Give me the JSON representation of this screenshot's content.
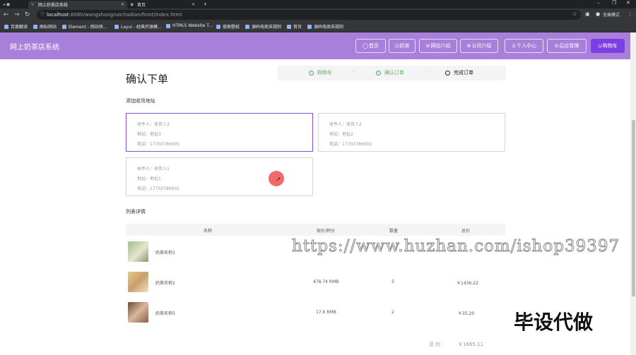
{
  "browser": {
    "tabs": [
      {
        "title": "网上奶茶店系统",
        "active": true
      },
      {
        "title": "首页",
        "active": false
      }
    ],
    "url_host": "localhost",
    "url_path": ":8080/wangshangnaichadian/front/index.html",
    "profile_label": "无痕模式",
    "bookmarks": [
      "百度翻译",
      "图标网站",
      "Element - 网站快...",
      "Layui - 经典开源模...",
      "HTML5 Website T...",
      "搜索壁纸",
      "源码电商采规则",
      "首页",
      "源码电商采规则"
    ]
  },
  "site": {
    "title": "网上奶茶店系统",
    "nav": [
      {
        "label": "首页",
        "icon": "home-icon",
        "glyph": "◯"
      },
      {
        "label": "奶茶",
        "icon": "cup-icon",
        "glyph": "◷"
      },
      {
        "label": "网站介绍",
        "icon": "list-icon",
        "glyph": "≡"
      },
      {
        "label": "公司介绍",
        "icon": "building-icon",
        "glyph": "⊕"
      },
      {
        "label": "个人中心",
        "icon": "user-icon",
        "glyph": "♙"
      },
      {
        "label": "后台管理",
        "icon": "link-icon",
        "glyph": "⊘"
      },
      {
        "label": "购物车",
        "icon": "cart-icon",
        "glyph": "⊔"
      }
    ]
  },
  "page": {
    "title": "确认下单",
    "steps": [
      {
        "label": "购物车",
        "done": true
      },
      {
        "label": "确认订单",
        "done": true
      },
      {
        "label": "完成订单",
        "done": false
      }
    ],
    "address_section_label": "添加收货地址",
    "addresses": [
      {
        "name": "收件人：收货人3",
        "address": "地址：地址3",
        "phone": "电话：17703786905"
      },
      {
        "name": "收件人：收货人2",
        "address": "地址：地址2",
        "phone": "电话：17703786902"
      },
      {
        "name": "收件人：收货人1",
        "address": "地址：地址1",
        "phone": "电话：17703786901"
      }
    ],
    "list_section_label": "列表详情",
    "table_headers": [
      "名称",
      "现价/积分",
      "数量",
      "总价"
    ],
    "rows": [
      {
        "name": "奶茶名称3",
        "price": "",
        "qty": "",
        "total": ""
      },
      {
        "name": "奶茶名称2",
        "price": "478.74 RMB",
        "qty": "3",
        "total": "￥1436.22"
      },
      {
        "name": "奶茶名称5",
        "price": "17.6 RMB",
        "qty": "2",
        "total": "￥35.20"
      }
    ],
    "total_label": "总 价:",
    "total_value": "￥1665.11"
  },
  "overlay": {
    "watermark_text": "https://www.huzhan.com/ishop39397",
    "corner_text": "毕设代做"
  }
}
